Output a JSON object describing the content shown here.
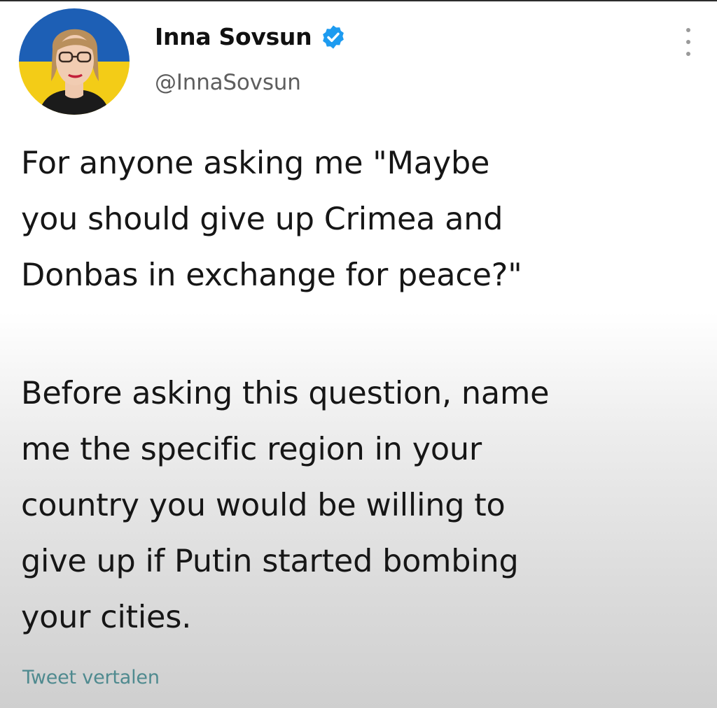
{
  "author": {
    "name": "Inna Sovsun",
    "handle": "@InnaSovsun",
    "verified": true,
    "avatar_icon": "profile-photo-with-ukraine-flag-background"
  },
  "tweet": {
    "paragraphs": [
      {
        "lines": [
          "For anyone asking me \"Maybe",
          "you should give up Crimea and",
          "Donbas in exchange for peace?\""
        ]
      },
      {
        "lines": [
          "Before asking this question, name",
          "me the specific region in your",
          "country you would be willing to",
          "give up if Putin started bombing",
          "your cities."
        ]
      }
    ],
    "translate_link": "Tweet vertalen"
  },
  "icons": {
    "more": "more-vertical-icon",
    "verified": "verified-badge-icon"
  },
  "colors": {
    "verified_blue": "#1d9bf0",
    "link": "#4f8a8f",
    "flag_blue": "#1d5fb5",
    "flag_yellow": "#f3cc17"
  }
}
